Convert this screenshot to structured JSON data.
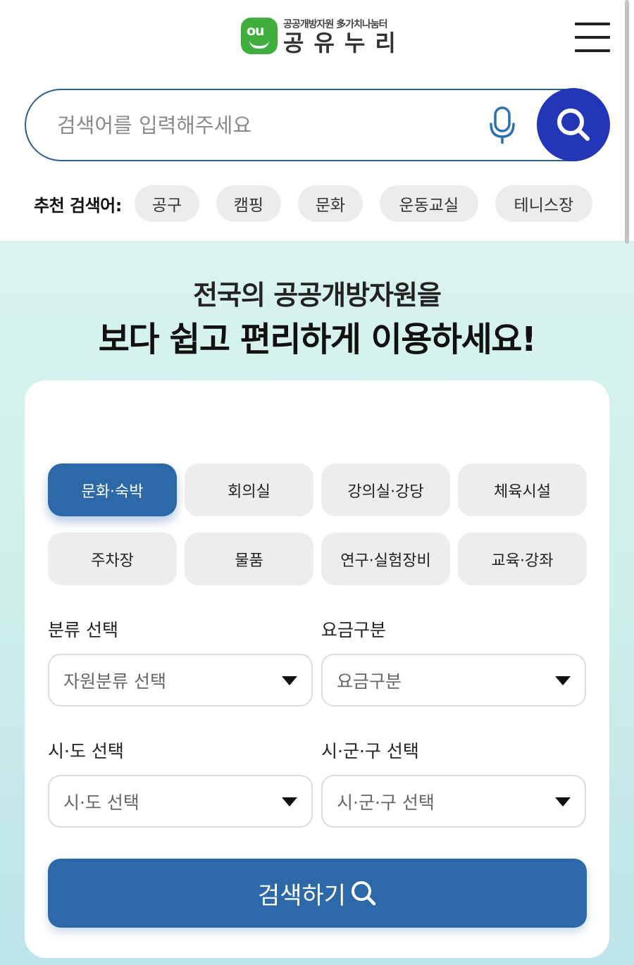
{
  "header": {
    "logo_sub": "공공개방자원 多가치나눔터",
    "logo_main": "공유누리",
    "logo_mark_text": "ou"
  },
  "search": {
    "placeholder": "검색어를 입력해주세요"
  },
  "recommended": {
    "label": "추천 검색어:",
    "chips": [
      "공구",
      "캠핑",
      "문화",
      "운동교실",
      "테니스장"
    ]
  },
  "headline": {
    "line1": "전국의 공공개방자원을",
    "line2": "보다 쉽고 편리하게 이용하세요!"
  },
  "categories": [
    {
      "label": "문화·숙박",
      "active": true
    },
    {
      "label": "회의실",
      "active": false
    },
    {
      "label": "강의실·강당",
      "active": false
    },
    {
      "label": "체육시설",
      "active": false
    },
    {
      "label": "주차장",
      "active": false
    },
    {
      "label": "물품",
      "active": false
    },
    {
      "label": "연구·실험장비",
      "active": false
    },
    {
      "label": "교육·강좌",
      "active": false
    }
  ],
  "filters": {
    "category": {
      "label": "분류 선택",
      "value": "자원분류 선택"
    },
    "fee": {
      "label": "요금구분",
      "value": "요금구분"
    },
    "province": {
      "label": "시·도 선택",
      "value": "시·도 선택"
    },
    "district": {
      "label": "시·군·구 선택",
      "value": "시·군·구 선택"
    }
  },
  "submit_label": "검색하기",
  "colors": {
    "brand_green": "#3fae3c",
    "primary_blue": "#2d69a8",
    "search_button": "#2535b8"
  },
  "icons": {
    "mic": "microphone-icon",
    "search": "search-icon",
    "menu": "hamburger-menu-icon"
  }
}
